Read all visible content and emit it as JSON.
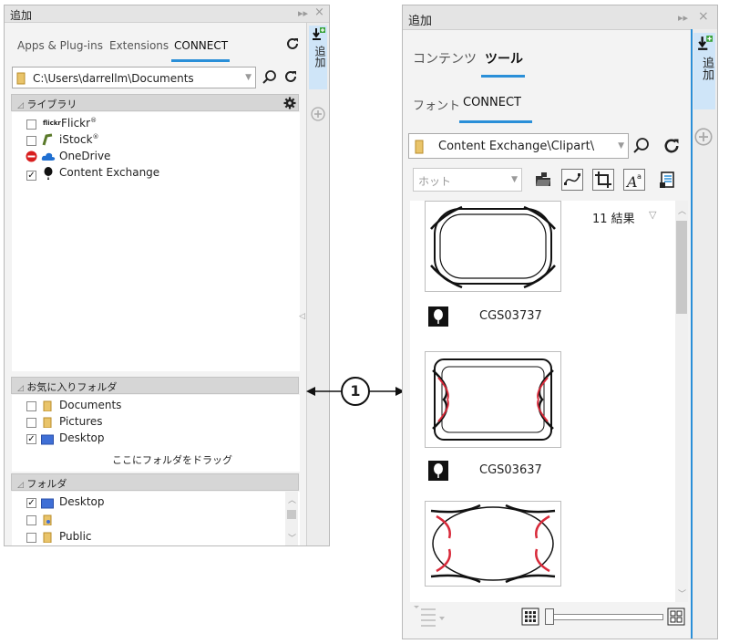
{
  "left_panel": {
    "title": "追加",
    "tabs": [
      "Apps & Plug-ins",
      "Extensions",
      "CONNECT"
    ],
    "path_value": "C:\\Users\\darrellm\\Documents",
    "library_header": "ライブラリ",
    "library_items": [
      {
        "label": "Flickr",
        "sup": "®",
        "prefix": "flickr",
        "checked": false
      },
      {
        "label": "iStock",
        "sup": "®",
        "checked": false
      },
      {
        "label": "OneDrive",
        "checked": false
      },
      {
        "label": "Content Exchange",
        "checked": true
      }
    ],
    "favorites_header": "お気に入りフォルダ",
    "favorites_items": [
      {
        "label": "Documents",
        "checked": false
      },
      {
        "label": "Pictures",
        "checked": false
      },
      {
        "label": "Desktop",
        "checked": true
      }
    ],
    "drag_hint": "ここにフォルダをドラッグ",
    "folders_header": "フォルダ",
    "folders_items": [
      {
        "label": "Desktop",
        "checked": true
      },
      {
        "label": "",
        "checked": false
      },
      {
        "label": "Public",
        "checked": false
      }
    ],
    "side_tab_label": "追加"
  },
  "callout_number": "1",
  "right_panel": {
    "title": "追加",
    "tabs_top": [
      "コンテンツ",
      "ツール"
    ],
    "tabs_second": [
      "フォント",
      "CONNECT"
    ],
    "path_value": "Content Exchange\\Clipart\\",
    "filter_placeholder": "ホット",
    "results": "11 結果",
    "items": [
      {
        "code": "CGS03737"
      },
      {
        "code": "CGS03637"
      }
    ],
    "side_tab_label": "追加"
  },
  "colors": {
    "accent": "#2a8fd8",
    "side_tab": "#cfe5f8",
    "blocked": "#d81e1e",
    "onedrive": "#1f6fd1",
    "folder_blue": "#3f6fd6"
  }
}
